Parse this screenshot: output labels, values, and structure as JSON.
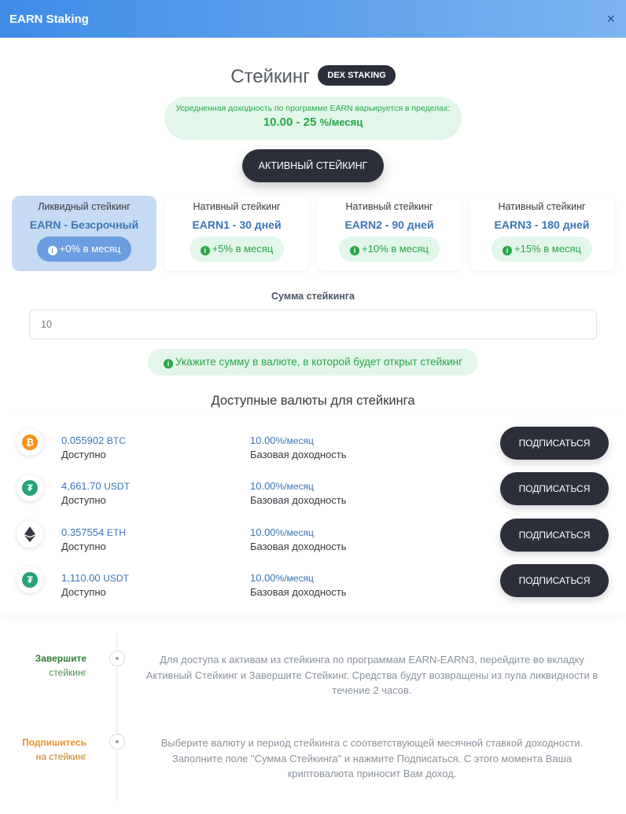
{
  "header": {
    "title": "EARN Staking",
    "close": "×"
  },
  "main": {
    "title": "Стейкинг",
    "badge": "DEX STAKING",
    "yield": {
      "caption": "Усредненная доходность по программе EARN варьируется в пределах:",
      "range": "10.00 - 25",
      "unit": "%/месяц"
    },
    "active_button": "АКТИВНЫЙ СТЕЙКИНГ"
  },
  "cards": [
    {
      "label": "Ликвидный стейкинг",
      "title": "EARN - Безсрочный",
      "rate": "+0% в месяц",
      "selected": true
    },
    {
      "label": "Нативный стейкинг",
      "title": "EARN1 - 30 дней",
      "rate": "+5% в месяц",
      "selected": false
    },
    {
      "label": "Нативный стейкинг",
      "title": "EARN2 - 90 дней",
      "rate": "+10% в месяц",
      "selected": false
    },
    {
      "label": "Нативный стейкинг",
      "title": "EARN3 - 180 дней",
      "rate": "+15% в месяц",
      "selected": false
    }
  ],
  "amount": {
    "label": "Сумма стейкинга",
    "value": "10"
  },
  "hint": "Укажите сумму в валюте, в которой будет открыт стейкинг",
  "currencies_title": "Доступные валюты для стейкинга",
  "currencies": [
    {
      "icon": "btc-icon",
      "amount": "0.055902",
      "unit": "BTC",
      "available": "Доступно",
      "rate": "10.00",
      "rate_unit": "%/месяц",
      "rate_label": "Базовая доходность",
      "button": "ПОДПИСАТЬСЯ"
    },
    {
      "icon": "usdt-icon",
      "amount": "4,661.70",
      "unit": "USDT",
      "available": "Доступно",
      "rate": "10.00",
      "rate_unit": "%/месяц",
      "rate_label": "Базовая доходность",
      "button": "ПОДПИСАТЬСЯ"
    },
    {
      "icon": "eth-icon",
      "amount": "0.357554",
      "unit": "ETH",
      "available": "Доступно",
      "rate": "10.00",
      "rate_unit": "%/месяц",
      "rate_label": "Базовая доходность",
      "button": "ПОДПИСАТЬСЯ"
    },
    {
      "icon": "usdt-icon",
      "amount": "1,110.00",
      "unit": "USDT",
      "available": "Доступно",
      "rate": "10.00",
      "rate_unit": "%/месяц",
      "rate_label": "Базовая доходность",
      "button": "ПОДПИСАТЬСЯ"
    }
  ],
  "timeline": [
    {
      "title": "Завершите",
      "subtitle": "стейкинг",
      "color": "#2e7d32",
      "text": "Для доступа к активам из стейкинга по программам EARN-EARN3, перейдите во вкладку Активный Стейкинг и Завершите Стейкинг. Средства будут возвращены из пула ликвидности в течение 2 часов."
    },
    {
      "title": "Подпишитесь",
      "subtitle": "на стейкинг",
      "color": "#e8912d",
      "text": "Выберите валюту и период стейкинга с соответствующей месячной ставкой доходности. Заполните поле \"Сумма Стейкинга\" и нажмите Подписаться. С этого момента Ваша криптовалюта приносит Вам доход."
    }
  ],
  "colors": {
    "accent": "#3a75b5",
    "success": "#28a745",
    "dark_button": "#2c2f3a",
    "header_start": "#3f8ce8",
    "header_end": "#7cb4f0"
  }
}
